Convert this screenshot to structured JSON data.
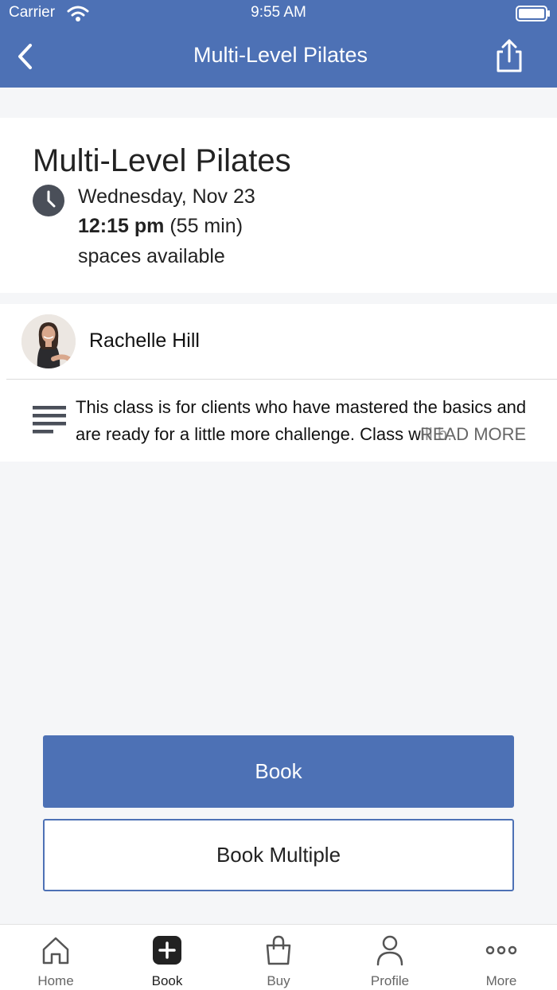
{
  "status_bar": {
    "carrier": "Carrier",
    "time": "9:55 AM"
  },
  "nav": {
    "title": "Multi-Level Pilates"
  },
  "class_info": {
    "title": "Multi-Level Pilates",
    "date": "Wednesday, Nov 23",
    "time": "12:15 pm",
    "duration": "(55 min)",
    "availability": "spaces available"
  },
  "instructor": {
    "name": "Rachelle Hill"
  },
  "description": {
    "text": "This class is for clients who have mastered the basics and are ready for a little more challenge. Class will b.",
    "read_more": "READ MORE"
  },
  "actions": {
    "book": "Book",
    "book_multiple": "Book Multiple"
  },
  "tabs": [
    {
      "label": "Home",
      "icon": "home-icon"
    },
    {
      "label": "Book",
      "icon": "plus-square-icon",
      "active": true
    },
    {
      "label": "Buy",
      "icon": "shopping-bag-icon"
    },
    {
      "label": "Profile",
      "icon": "person-icon"
    },
    {
      "label": "More",
      "icon": "more-dots-icon"
    }
  ],
  "colors": {
    "brand": "#4d71b5",
    "background": "#f5f6f8"
  }
}
